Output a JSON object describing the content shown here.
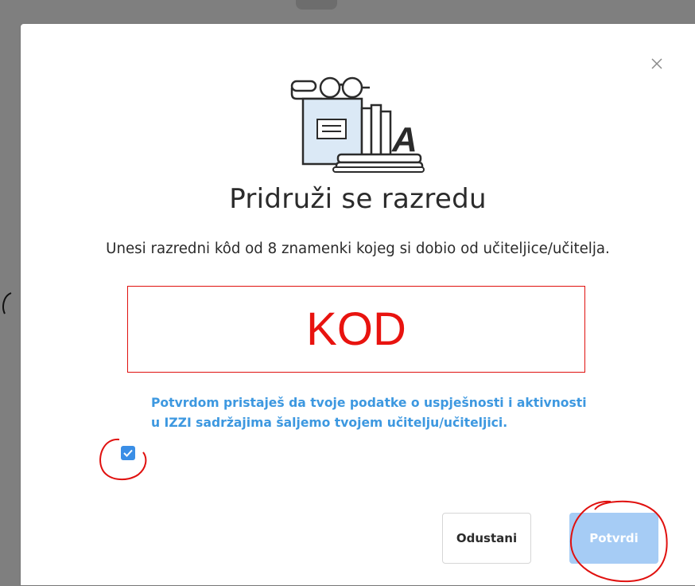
{
  "dialog": {
    "title": "Pridruži se razredu",
    "instruction": "Unesi razredni kôd od 8 znamenki kojeg si dobio od učiteljice/učitelja.",
    "code_input": {
      "value": "",
      "placeholder": "KOD"
    },
    "consent": {
      "checked": true,
      "text": "Potvrdom pristaješ da tvoje podatke o uspješnosti i aktivnosti u IZZI sadržajima šaljemo tvojem učitelju/učiteljici."
    },
    "buttons": {
      "cancel_label": "Odustani",
      "confirm_label": "Potvrdi"
    },
    "icons": {
      "close": "close-icon",
      "illustration": "books-glasses-illustration",
      "checkbox": "checkmark-icon"
    }
  },
  "colors": {
    "annotation_red": "#e0110f",
    "accent_blue": "#3a8ee6",
    "consent_text": "#3d98e0",
    "confirm_disabled": "#a6ccf5"
  }
}
